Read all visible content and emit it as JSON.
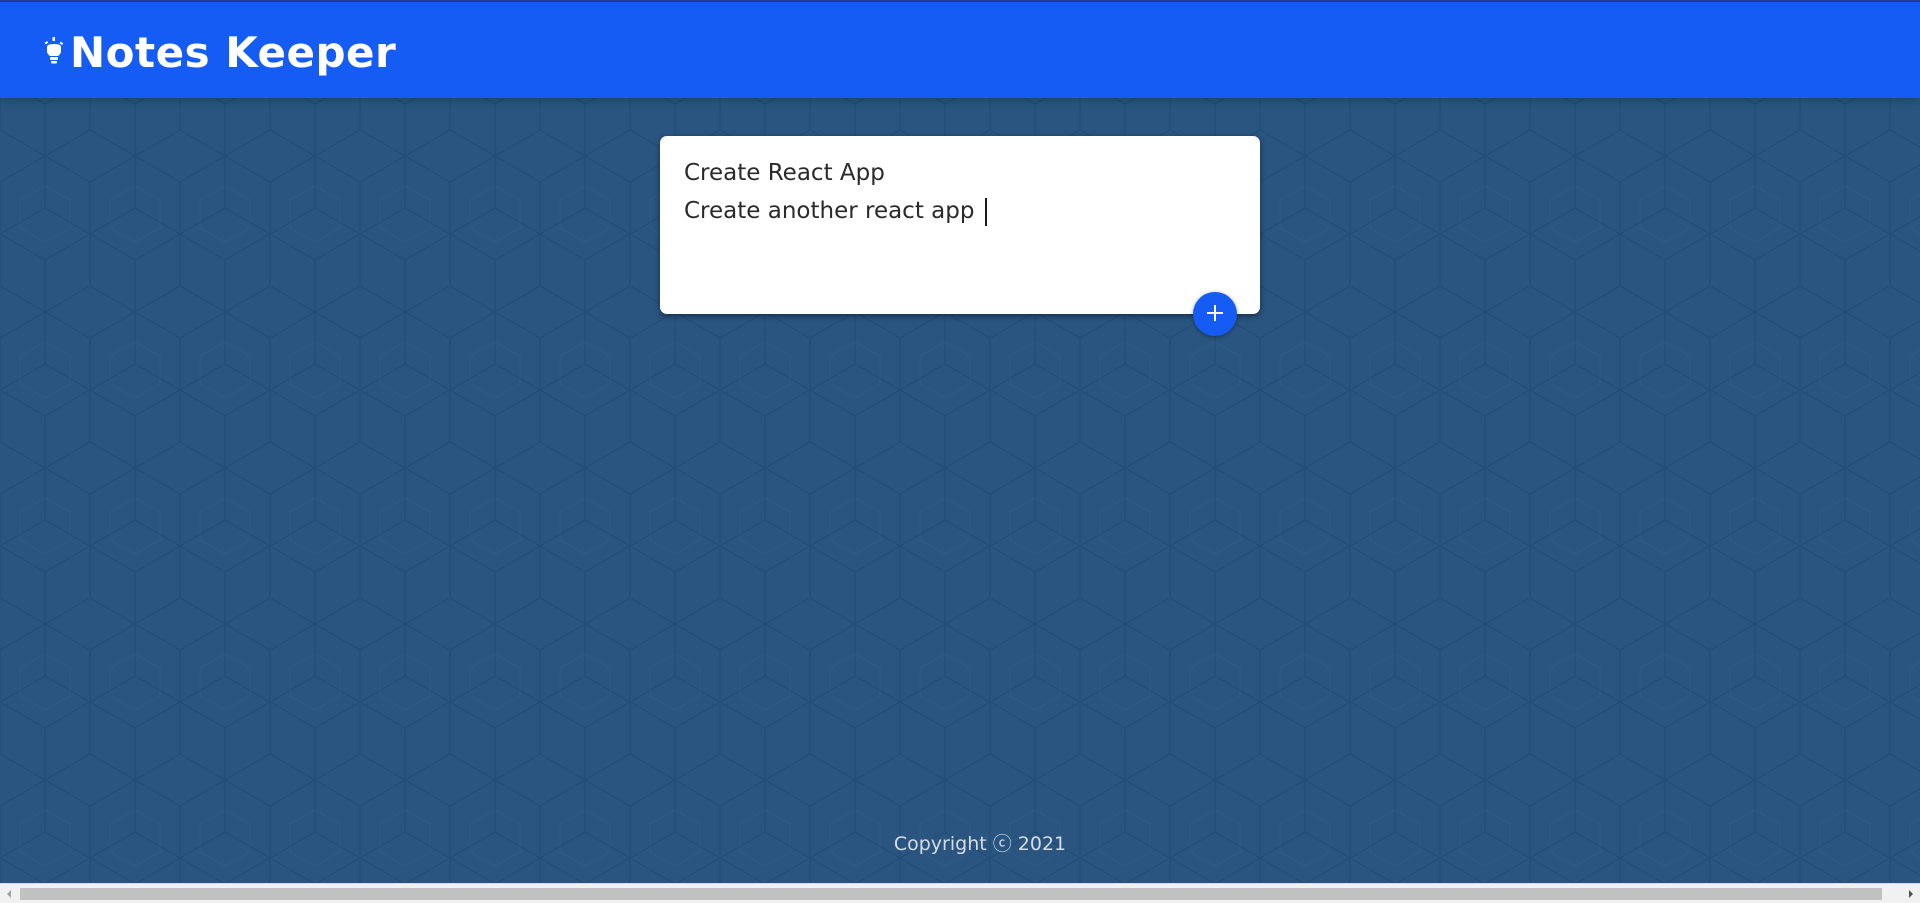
{
  "app": {
    "title": "Notes Keeper",
    "logo_icon": "lightbulb-icon"
  },
  "note_form": {
    "title_value": "Create React App",
    "content_value": "Create another react app",
    "add_button_icon": "plus-icon"
  },
  "footer": {
    "copyright_text": "Copyright ⓒ 2021"
  },
  "colors": {
    "header": "#155cf5",
    "background": "#295580",
    "card": "#ffffff",
    "add_button": "#155cf5",
    "footer_text": "#d6dce4"
  }
}
